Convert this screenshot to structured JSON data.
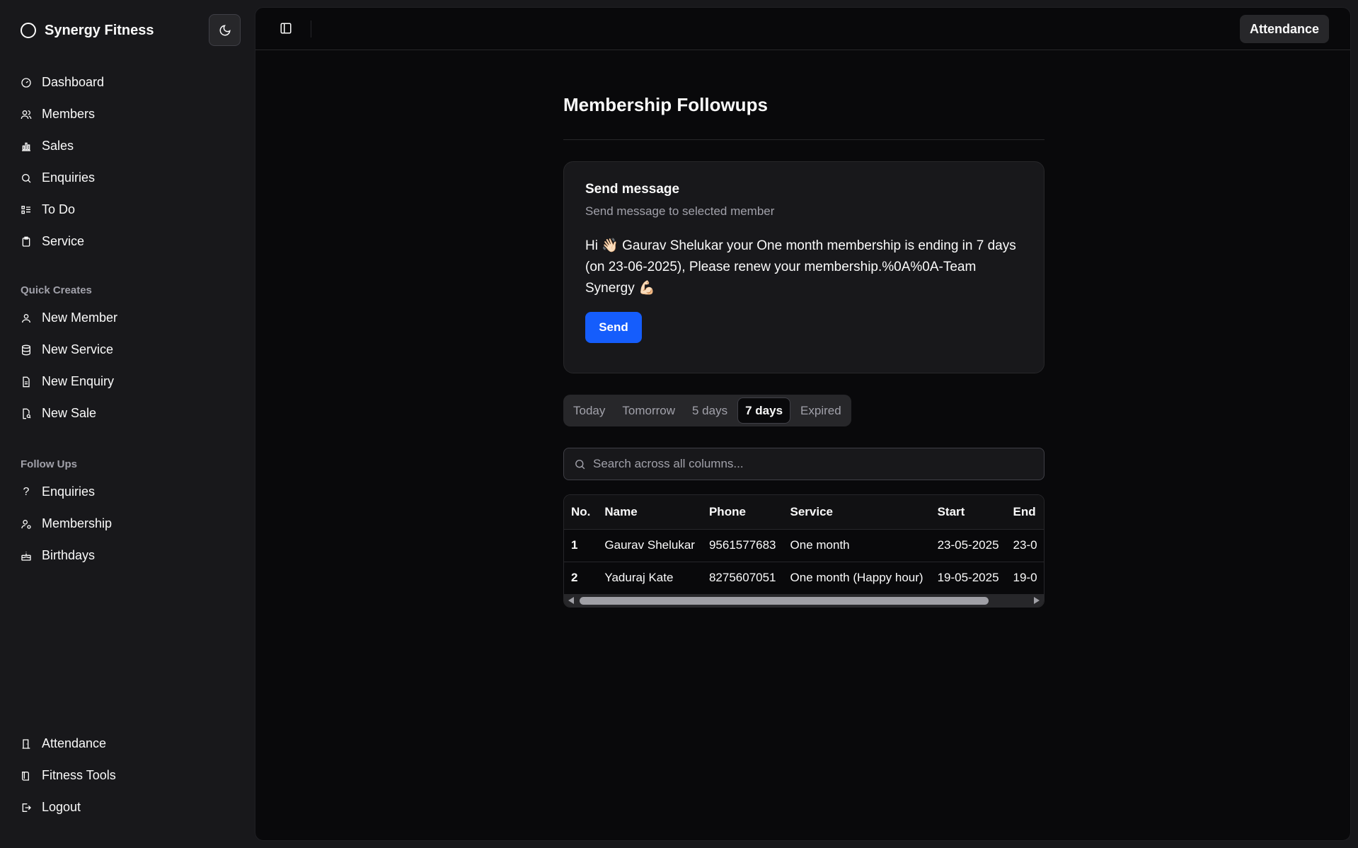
{
  "sidebar": {
    "brand": "Synergy Fitness",
    "main_items": [
      {
        "label": "Dashboard",
        "icon": "gauge-icon"
      },
      {
        "label": "Members",
        "icon": "users-icon"
      },
      {
        "label": "Sales",
        "icon": "bar-chart-icon"
      },
      {
        "label": "Enquiries",
        "icon": "search-icon"
      },
      {
        "label": "To Do",
        "icon": "list-todo-icon"
      },
      {
        "label": "Service",
        "icon": "clipboard-icon"
      }
    ],
    "quick_creates_label": "Quick Creates",
    "quick_items": [
      {
        "label": "New Member",
        "icon": "user-icon"
      },
      {
        "label": "New Service",
        "icon": "database-icon"
      },
      {
        "label": "New Enquiry",
        "icon": "file-text-icon"
      },
      {
        "label": "New Sale",
        "icon": "file-search-icon"
      }
    ],
    "follow_ups_label": "Follow Ups",
    "follow_items": [
      {
        "label": "Enquiries",
        "icon": "question-icon"
      },
      {
        "label": "Membership",
        "icon": "user-clock-icon"
      },
      {
        "label": "Birthdays",
        "icon": "cake-icon"
      }
    ],
    "bottom_items": [
      {
        "label": "Attendance",
        "icon": "door-icon"
      },
      {
        "label": "Fitness Tools",
        "icon": "book-icon"
      },
      {
        "label": "Logout",
        "icon": "logout-icon"
      }
    ]
  },
  "topbar": {
    "attendance_label": "Attendance"
  },
  "page": {
    "title": "Membership Followups"
  },
  "card": {
    "title": "Send message",
    "subtitle": "Send message to selected member",
    "message": "Hi 👋🏻 Gaurav Shelukar your One month membership is ending in 7 days (on 23-06-2025), Please renew your membership.%0A%0A-Team Synergy 💪🏻",
    "send_label": "Send"
  },
  "tabs": [
    {
      "label": "Today",
      "active": false
    },
    {
      "label": "Tomorrow",
      "active": false
    },
    {
      "label": "5 days",
      "active": false
    },
    {
      "label": "7 days",
      "active": true
    },
    {
      "label": "Expired",
      "active": false
    }
  ],
  "search": {
    "placeholder": "Search across all columns..."
  },
  "table": {
    "headers": [
      "No.",
      "Name",
      "Phone",
      "Service",
      "Start",
      "End"
    ],
    "rows": [
      [
        "1",
        "Gaurav Shelukar",
        "9561577683",
        "One month",
        "23-05-2025",
        "23-0"
      ],
      [
        "2",
        "Yaduraj Kate",
        "8275607051",
        "One month (Happy hour)",
        "19-05-2025",
        "19-0"
      ]
    ]
  },
  "colors": {
    "accent": "#155dfc",
    "background": "#09090b",
    "sidebar": "#18181b"
  }
}
